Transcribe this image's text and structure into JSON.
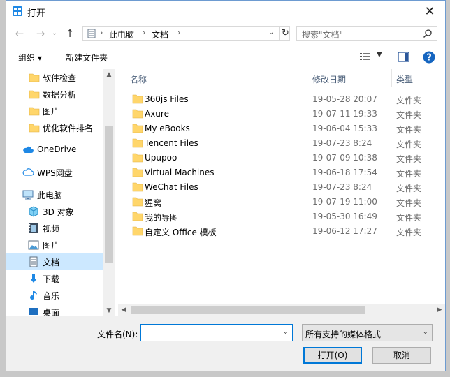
{
  "title": "打开",
  "nav": {
    "back_glyph": "←",
    "forward_glyph": "→",
    "up_glyph": "↑",
    "address": [
      "此电脑",
      "文档"
    ],
    "search_placeholder": "搜索\"文档\""
  },
  "toolbar": {
    "organize": "组织 ▾",
    "new_folder": "新建文件夹"
  },
  "sidebar": {
    "items": [
      {
        "label": "软件检查",
        "icon": "folder-icon"
      },
      {
        "label": "数据分析",
        "icon": "folder-icon"
      },
      {
        "label": "图片",
        "icon": "folder-icon"
      },
      {
        "label": "优化软件排名",
        "icon": "folder-icon"
      },
      {
        "label": "OneDrive",
        "icon": "cloud-icon"
      },
      {
        "label": "WPS网盘",
        "icon": "cloud-outline-icon"
      },
      {
        "label": "此电脑",
        "icon": "computer-icon"
      },
      {
        "label": "3D 对象",
        "icon": "cube-icon"
      },
      {
        "label": "视频",
        "icon": "video-icon"
      },
      {
        "label": "图片",
        "icon": "picture-icon"
      },
      {
        "label": "文档",
        "icon": "document-icon"
      },
      {
        "label": "下载",
        "icon": "download-icon"
      },
      {
        "label": "音乐",
        "icon": "music-icon"
      },
      {
        "label": "桌面",
        "icon": "desktop-icon"
      }
    ],
    "selected_index": 10
  },
  "columns": {
    "name": "名称",
    "date": "修改日期",
    "type": "类型"
  },
  "files": [
    {
      "name": "360js Files",
      "date": "19-05-28 20:07",
      "type": "文件夹"
    },
    {
      "name": "Axure",
      "date": "19-07-11 19:33",
      "type": "文件夹"
    },
    {
      "name": "My eBooks",
      "date": "19-06-04 15:33",
      "type": "文件夹"
    },
    {
      "name": "Tencent Files",
      "date": "19-07-23 8:24",
      "type": "文件夹"
    },
    {
      "name": "Upupoo",
      "date": "19-07-09 10:38",
      "type": "文件夹"
    },
    {
      "name": "Virtual Machines",
      "date": "19-06-18 17:54",
      "type": "文件夹"
    },
    {
      "name": "WeChat Files",
      "date": "19-07-23 8:24",
      "type": "文件夹"
    },
    {
      "name": "猩窝",
      "date": "19-07-19 11:00",
      "type": "文件夹"
    },
    {
      "name": "我的导图",
      "date": "19-05-30 16:49",
      "type": "文件夹"
    },
    {
      "name": "自定义 Office 模板",
      "date": "19-06-12 17:27",
      "type": "文件夹"
    }
  ],
  "bottom": {
    "filename_label": "文件名(N):",
    "filename_value": "",
    "filter": "所有支持的媒体格式",
    "open_label": "打开(O)",
    "cancel_label": "取消"
  },
  "colors": {
    "accent": "#0078d7",
    "selected": "#cce8ff",
    "folder": "#ffd66b"
  }
}
